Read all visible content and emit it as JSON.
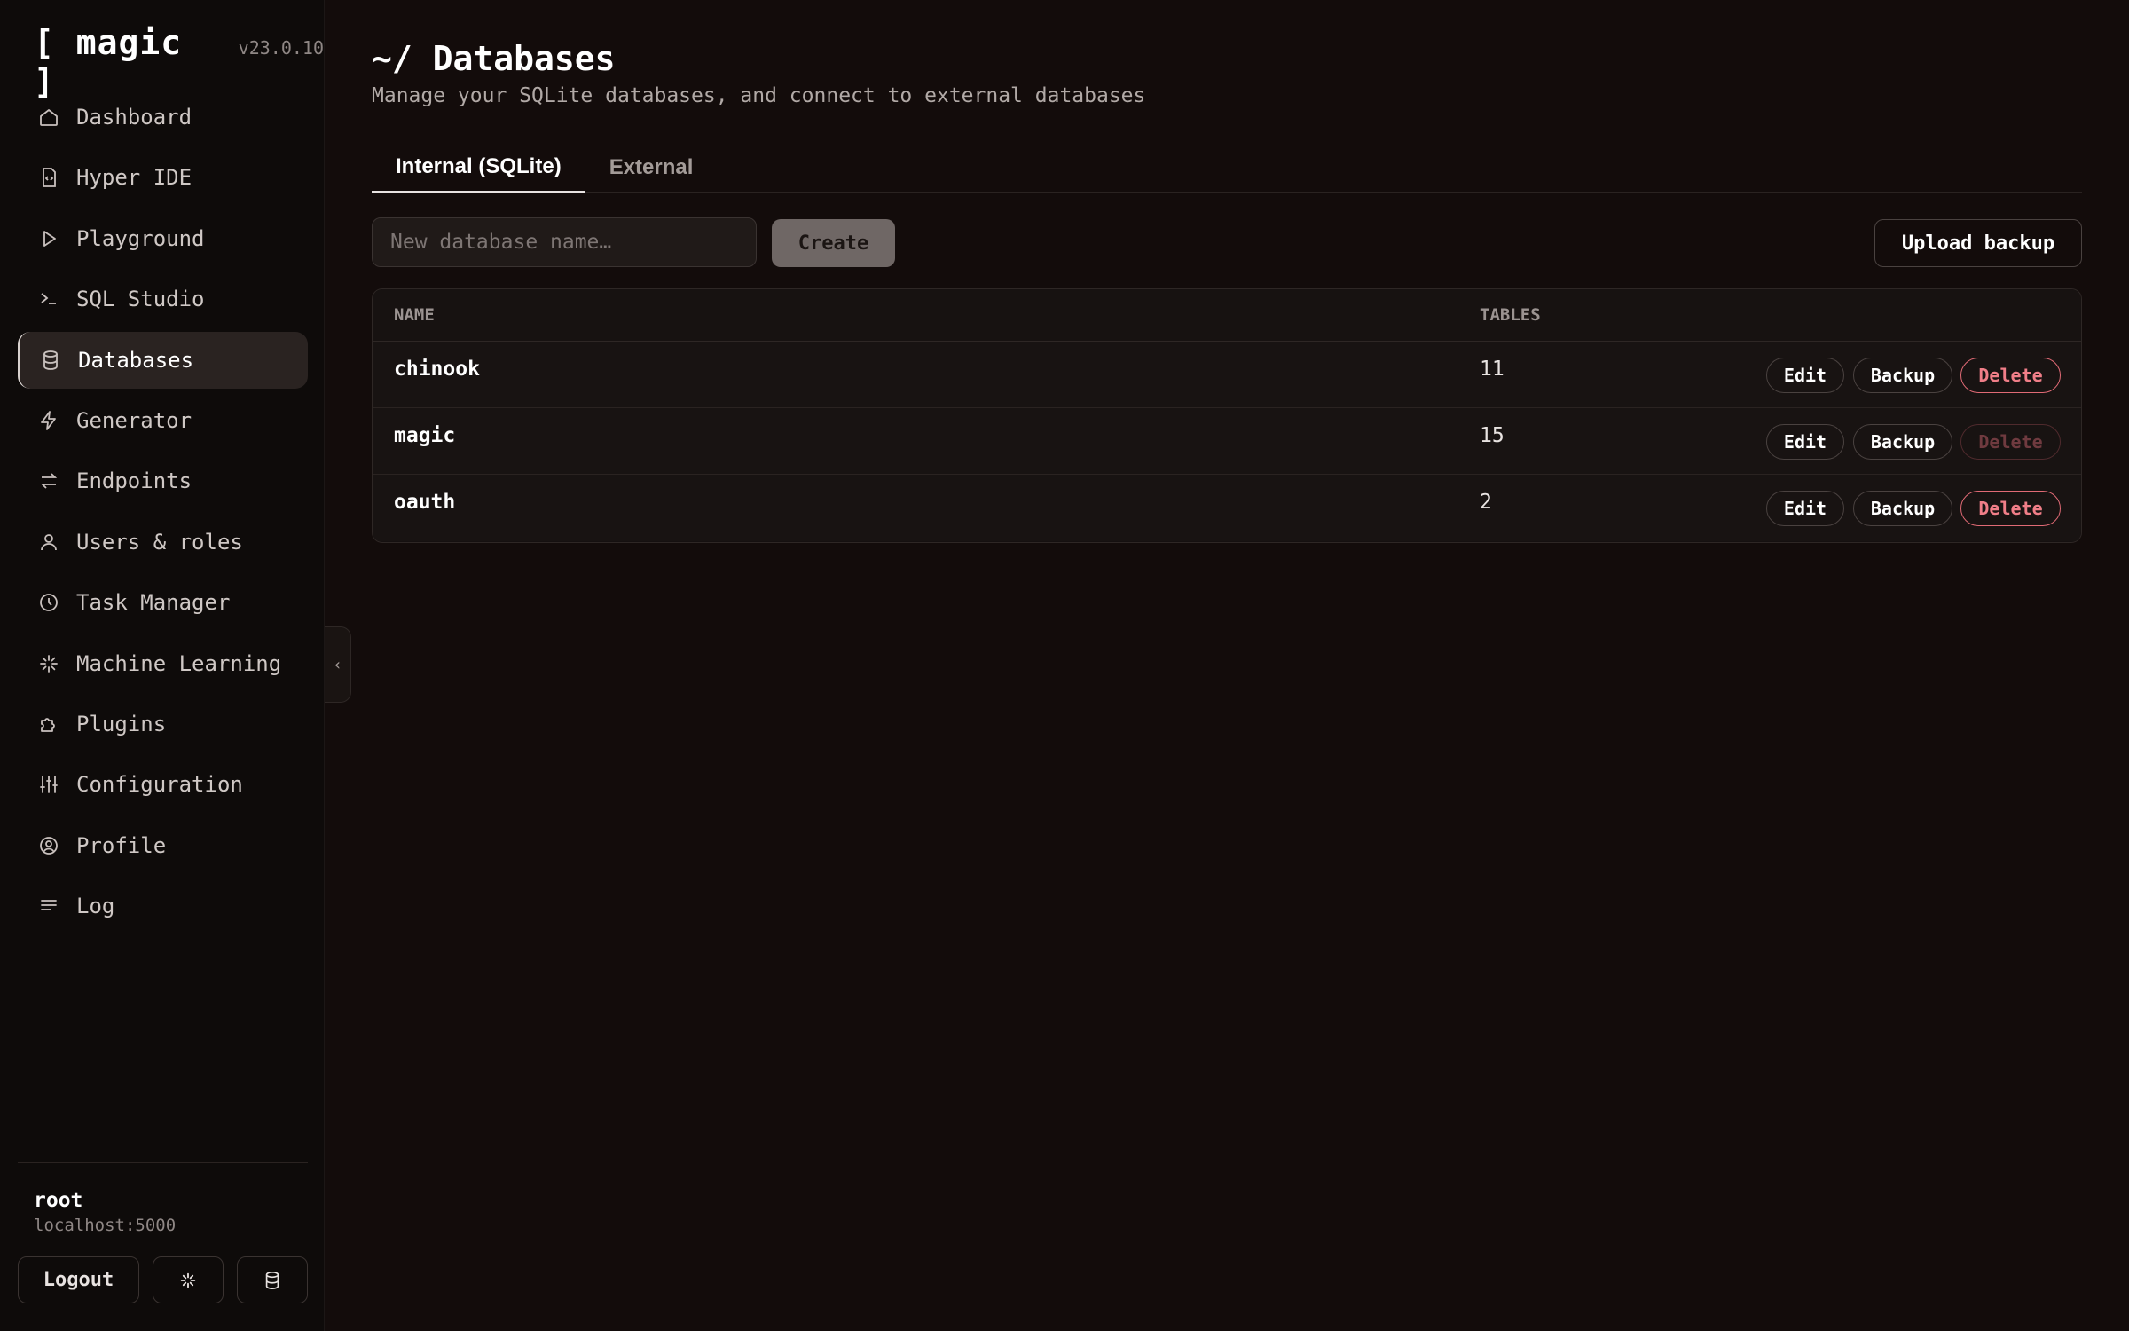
{
  "app": {
    "brand": "[ magic ]",
    "version": "v23.0.10"
  },
  "sidebar": {
    "items": [
      {
        "label": "Dashboard",
        "icon": "home-icon"
      },
      {
        "label": "Hyper IDE",
        "icon": "code-file-icon"
      },
      {
        "label": "Playground",
        "icon": "play-icon"
      },
      {
        "label": "SQL Studio",
        "icon": "terminal-icon"
      },
      {
        "label": "Databases",
        "icon": "database-icon",
        "active": true
      },
      {
        "label": "Generator",
        "icon": "lightning-icon"
      },
      {
        "label": "Endpoints",
        "icon": "arrows-icon"
      },
      {
        "label": "Users & roles",
        "icon": "user-icon"
      },
      {
        "label": "Task Manager",
        "icon": "clock-icon"
      },
      {
        "label": "Machine Learning",
        "icon": "sparkle-icon"
      },
      {
        "label": "Plugins",
        "icon": "puzzle-icon"
      },
      {
        "label": "Configuration",
        "icon": "sliders-icon"
      },
      {
        "label": "Profile",
        "icon": "user-circle-icon"
      },
      {
        "label": "Log",
        "icon": "list-icon"
      }
    ],
    "user": {
      "name": "root",
      "host": "localhost:5000"
    },
    "logout_label": "Logout",
    "collapse_glyph": "‹"
  },
  "main": {
    "title": "~/ Databases",
    "subtitle": "Manage your SQLite databases, and connect to external databases",
    "tabs": [
      {
        "label": "Internal (SQLite)",
        "active": true
      },
      {
        "label": "External",
        "active": false
      }
    ],
    "new_db_placeholder": "New database name…",
    "create_label": "Create",
    "upload_label": "Upload backup",
    "table": {
      "headers": [
        "NAME",
        "TABLES"
      ],
      "rows": [
        {
          "name": "chinook",
          "tables": "11",
          "delete_enabled": true
        },
        {
          "name": "magic",
          "tables": "15",
          "delete_enabled": false
        },
        {
          "name": "oauth",
          "tables": "2",
          "delete_enabled": true
        }
      ],
      "actions": {
        "edit": "Edit",
        "backup": "Backup",
        "delete": "Delete"
      }
    }
  },
  "colors": {
    "background": "#130c0b",
    "sidebar": "#0e0b0a",
    "delete_accent": "#f07e88"
  }
}
